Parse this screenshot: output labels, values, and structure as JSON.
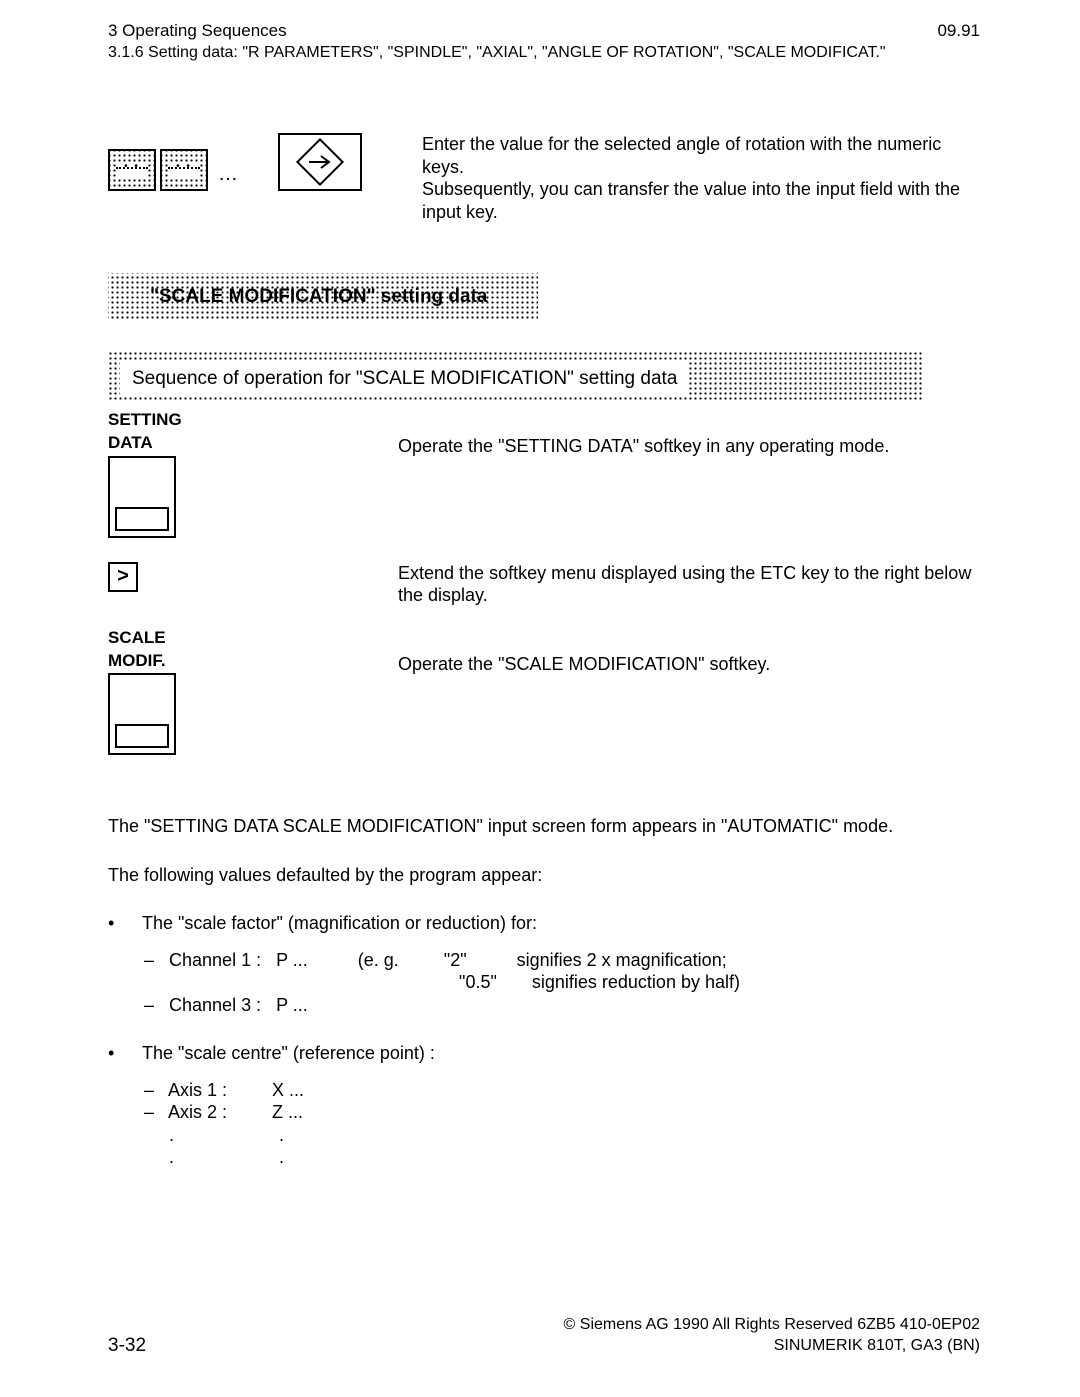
{
  "header": {
    "chapter": "3  Operating Sequences",
    "date": "09.91",
    "subsection": "3.1.6  Setting data: \"R PARAMETERS\", \"SPINDLE\", \"AXIAL\", \"ANGLE OF ROTATION\", \"SCALE MODIFICAT.\""
  },
  "intro_text1": "Enter the value for the selected angle of rotation with the numeric keys.",
  "intro_text2": "Subsequently, you can transfer the value into the input field with the input key.",
  "ellipsis": "…",
  "section_title": "\"SCALE MODIFICATION\" setting data",
  "seq_title": "Sequence of operation for \"SCALE MODIFICATION\" setting data",
  "steps": [
    {
      "label1": "SETTING",
      "label2": "DATA",
      "text": "Operate the \"SETTING DATA\" softkey in any operating mode."
    },
    {
      "key_glyph": ">",
      "text": "Extend the softkey menu displayed using the ETC key to the right below the display."
    },
    {
      "label1": "SCALE",
      "label2": "MODIF.",
      "text": "Operate the \"SCALE MODIFICATION\" softkey."
    }
  ],
  "para1": "The \"SETTING DATA SCALE MODIFICATION\" input screen form appears in \"AUTOMATIC\" mode.",
  "para2": "The following values defaulted by the program appear:",
  "bullets": [
    {
      "text": "The \"scale factor\" (magnification or reduction) for:",
      "subitems": [
        "–   Channel 1 :   P ...          (e. g.         \"2\"          signifies 2 x magnification;",
        "                                                               \"0.5\"       signifies reduction by half)",
        "–   Channel 3 :   P ..."
      ]
    },
    {
      "text": "The \"scale centre\" (reference point) :",
      "subitems": [
        "–   Axis 1 :         X ...",
        "–   Axis 2 :         Z ...",
        "     .                     .",
        "     .                     ."
      ]
    }
  ],
  "footer": {
    "page": "3-32",
    "copyright": "© Siemens AG 1990 All Rights Reserved      6ZB5 410-0EP02",
    "product": "SINUMERIK 810T, GA3 (BN)"
  }
}
